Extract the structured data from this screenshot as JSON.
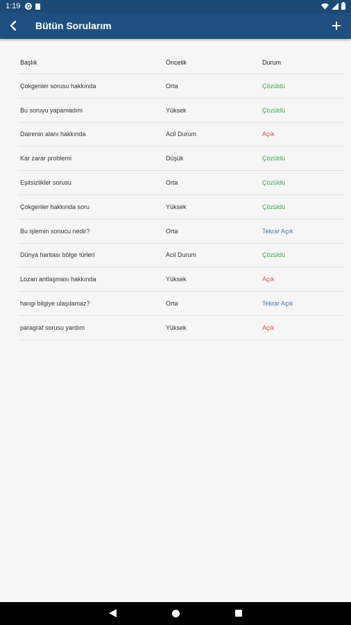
{
  "status_bar": {
    "time": "1:19"
  },
  "app_bar": {
    "title": "Bütün Sorularım"
  },
  "table": {
    "headers": [
      "Başlık",
      "Öncelik",
      "Durum"
    ],
    "rows": [
      {
        "title": "Çokgenler sorusu hakkında",
        "priority": "Orta",
        "status": "Çözüldü",
        "status_color": "#3aa548"
      },
      {
        "title": "Bu soruyu yapamadım",
        "priority": "Yüksek",
        "status": "Çözüldü",
        "status_color": "#3aa548"
      },
      {
        "title": "Dairenin alanı hakkında",
        "priority": "Acil Durum",
        "status": "Açık",
        "status_color": "#e64a3a"
      },
      {
        "title": "Kar zarar problemi",
        "priority": "Düşük",
        "status": "Çözüldü",
        "status_color": "#3aa548"
      },
      {
        "title": "Eşitsizlikler sorusu",
        "priority": "Orta",
        "status": "Çözüldü",
        "status_color": "#3aa548"
      },
      {
        "title": "Çokgenler hakkında soru",
        "priority": "Yüksek",
        "status": "Çözüldü",
        "status_color": "#3aa548"
      },
      {
        "title": "Bu işlemin sonucu nedir?",
        "priority": "Orta",
        "status": "Tekrar Açık",
        "status_color": "#3d78b0"
      },
      {
        "title": "Dünya haritası bölge türleri",
        "priority": "Acil Durum",
        "status": "Çözüldü",
        "status_color": "#3aa548"
      },
      {
        "title": "Lozan antlaşması hakkında",
        "priority": "Yüksek",
        "status": "Açık",
        "status_color": "#e64a3a"
      },
      {
        "title": "hangi bilgiye ulaşılamaz?",
        "priority": "Orta",
        "status": "Tekrar Açık",
        "status_color": "#3d78b0"
      },
      {
        "title": "paragraf sorusu yardım",
        "priority": "Yüksek",
        "status": "Açık",
        "status_color": "#e64a3a"
      }
    ]
  },
  "colors": {
    "app_bar": "#1f4f80",
    "status_bar": "#1d4975",
    "resolved": "#3aa548",
    "open": "#e64a3a",
    "reopened": "#3d78b0"
  },
  "icons": {
    "back": "arrow-back-icon",
    "add": "plus-icon"
  }
}
